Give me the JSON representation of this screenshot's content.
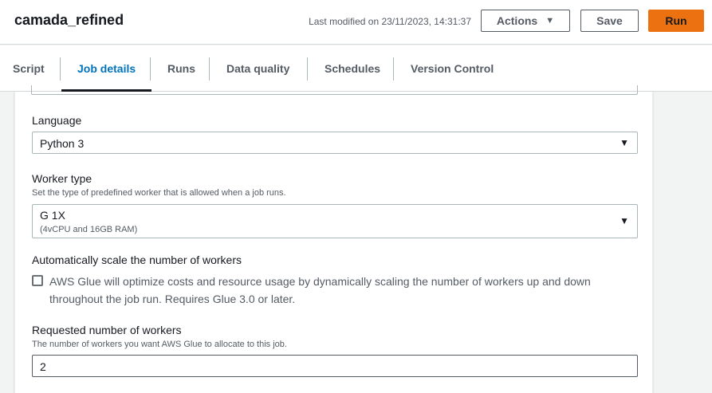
{
  "header": {
    "job_name": "camada_refined",
    "last_modified": "Last modified on 23/11/2023, 14:31:37",
    "actions_label": "Actions",
    "save_label": "Save",
    "run_label": "Run"
  },
  "tabs": [
    {
      "label": "Script"
    },
    {
      "label": "Job details",
      "active": true
    },
    {
      "label": "Runs"
    },
    {
      "label": "Data quality"
    },
    {
      "label": "Schedules"
    },
    {
      "label": "Version Control"
    }
  ],
  "form": {
    "language": {
      "label": "Language",
      "value": "Python 3"
    },
    "worker_type": {
      "label": "Worker type",
      "description": "Set the type of predefined worker that is allowed when a job runs.",
      "value": "G 1X",
      "sub_value": "(4vCPU and 16GB RAM)"
    },
    "autoscale": {
      "label": "Automatically scale the number of workers",
      "checkbox_text": "AWS Glue will optimize costs and resource usage by dynamically scaling the number of workers up and down throughout the job run. Requires Glue 3.0 or later.",
      "checked": false
    },
    "num_workers": {
      "label": "Requested number of workers",
      "description": "The number of workers you want AWS Glue to allocate to this job.",
      "value": "2"
    }
  },
  "colors": {
    "accent": "#0073bb",
    "run_button": "#ec7211",
    "background": "#f2f3f3"
  }
}
